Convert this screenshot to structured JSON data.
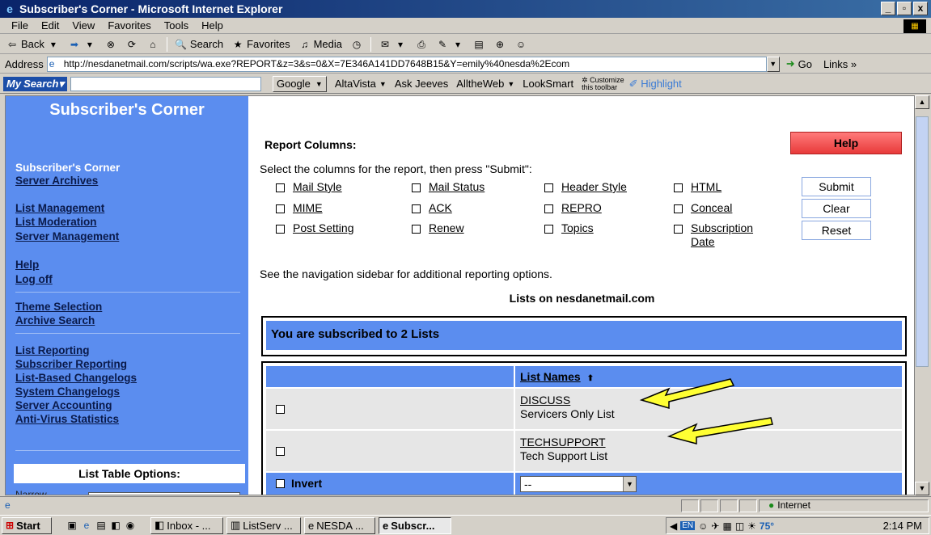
{
  "window": {
    "title": "Subscriber's Corner - Microsoft Internet Explorer",
    "min": "_",
    "max": "▫",
    "close": "x"
  },
  "menu": [
    "File",
    "Edit",
    "View",
    "Favorites",
    "Tools",
    "Help"
  ],
  "toolbar": {
    "back": "Back",
    "search": "Search",
    "favorites": "Favorites",
    "media": "Media"
  },
  "address": {
    "label": "Address",
    "url": "http://nesdanetmail.com/scripts/wa.exe?REPORT&z=3&s=0&X=7E346A141DD7648B15&Y=emily%40nesda%2Ecom",
    "go": "Go",
    "links": "Links"
  },
  "searchbar": {
    "my_search": "Search",
    "engine": "Google",
    "items": [
      "AltaVista",
      "Ask Jeeves",
      "AlltheWeb",
      "LookSmart"
    ],
    "customize_line1": "Customize",
    "customize_line2": "this toolbar",
    "highlight": "Highlight"
  },
  "sidebar": {
    "title": "Subscriber's Corner",
    "current": "Subscriber's Corner",
    "server_archives": "Server Archives",
    "list_management": "List Management",
    "list_moderation": "List Moderation",
    "server_management": "Server Management",
    "help": "Help",
    "log_off": "Log off",
    "theme_selection": "Theme Selection",
    "archive_search": "Archive Search",
    "list_reporting": "List Reporting",
    "subscriber_reporting": "Subscriber Reporting",
    "list_based_changelogs": "List-Based Changelogs",
    "system_changelogs": "System Changelogs",
    "server_accounting": "Server Accounting",
    "anti_virus": "Anti-Virus Statistics",
    "list_table_options": "List Table Options:",
    "narrow": "Narrow"
  },
  "main": {
    "report_columns": "Report Columns:",
    "help": "Help",
    "select_text": "Select the columns for the report, then press \"Submit\":",
    "options": [
      "Mail Style",
      "Mail Status",
      "Header Style",
      "HTML",
      "MIME",
      "ACK",
      "REPRO",
      "Conceal",
      "Post Setting",
      "Renew",
      "Topics",
      "Subscription Date"
    ],
    "submit": "Submit",
    "clear": "Clear",
    "reset": "Reset",
    "see_nav": "See the navigation sidebar for additional reporting options.",
    "lists_on": "Lists on nesdanetmail.com",
    "subscribed": "You are subscribed to 2 Lists",
    "list_names_header": "List Names",
    "lists": [
      {
        "name": "DISCUSS",
        "desc": "Servicers Only List"
      },
      {
        "name": "TECHSUPPORT",
        "desc": "Tech Support List"
      }
    ],
    "invert": "Invert",
    "invert_select": "--"
  },
  "status": {
    "zone": "Internet"
  },
  "taskbar": {
    "start": "Start",
    "tasks": [
      "Inbox - ...",
      "ListServ ...",
      "NESDA ...",
      "Subscr..."
    ],
    "temp": "75°",
    "clock": "2:14 PM"
  },
  "colors": {
    "sidebar_bg": "#5b8def",
    "help_btn": "#e83a3a",
    "arrow": "#ffff33"
  }
}
